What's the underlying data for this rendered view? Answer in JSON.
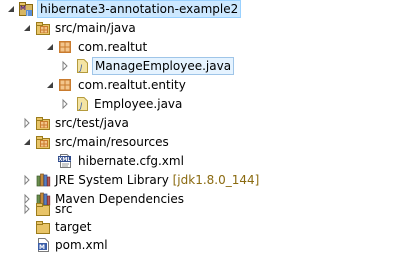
{
  "tree": {
    "project": {
      "label": "hibernate3-annotation-example2",
      "badge": "M"
    },
    "src_main_java": {
      "label": "src/main/java"
    },
    "pkg_realtut": {
      "label": "com.realtut"
    },
    "manage_employee": {
      "label": "ManageEmployee.java",
      "badge": "J"
    },
    "pkg_entity": {
      "label": "com.realtut.entity"
    },
    "employee": {
      "label": "Employee.java",
      "badge": "J"
    },
    "src_test_java": {
      "label": "src/test/java"
    },
    "src_main_resources": {
      "label": "src/main/resources"
    },
    "hibernate_cfg": {
      "label": "hibernate.cfg.xml",
      "badge": "XML"
    },
    "jre": {
      "label": "JRE System Library",
      "decoration": "[jdk1.8.0_144]"
    },
    "maven": {
      "label": "Maven Dependencies"
    },
    "src": {
      "label": "src"
    },
    "target": {
      "label": "target"
    },
    "pom": {
      "label": "pom.xml",
      "badge": "M"
    }
  },
  "colors": {
    "selection": "#cce8ff",
    "folder": "#e8c468",
    "package": "#c97b2e",
    "java_file": "#f4e4a4",
    "decoration": "#8a6a10"
  }
}
